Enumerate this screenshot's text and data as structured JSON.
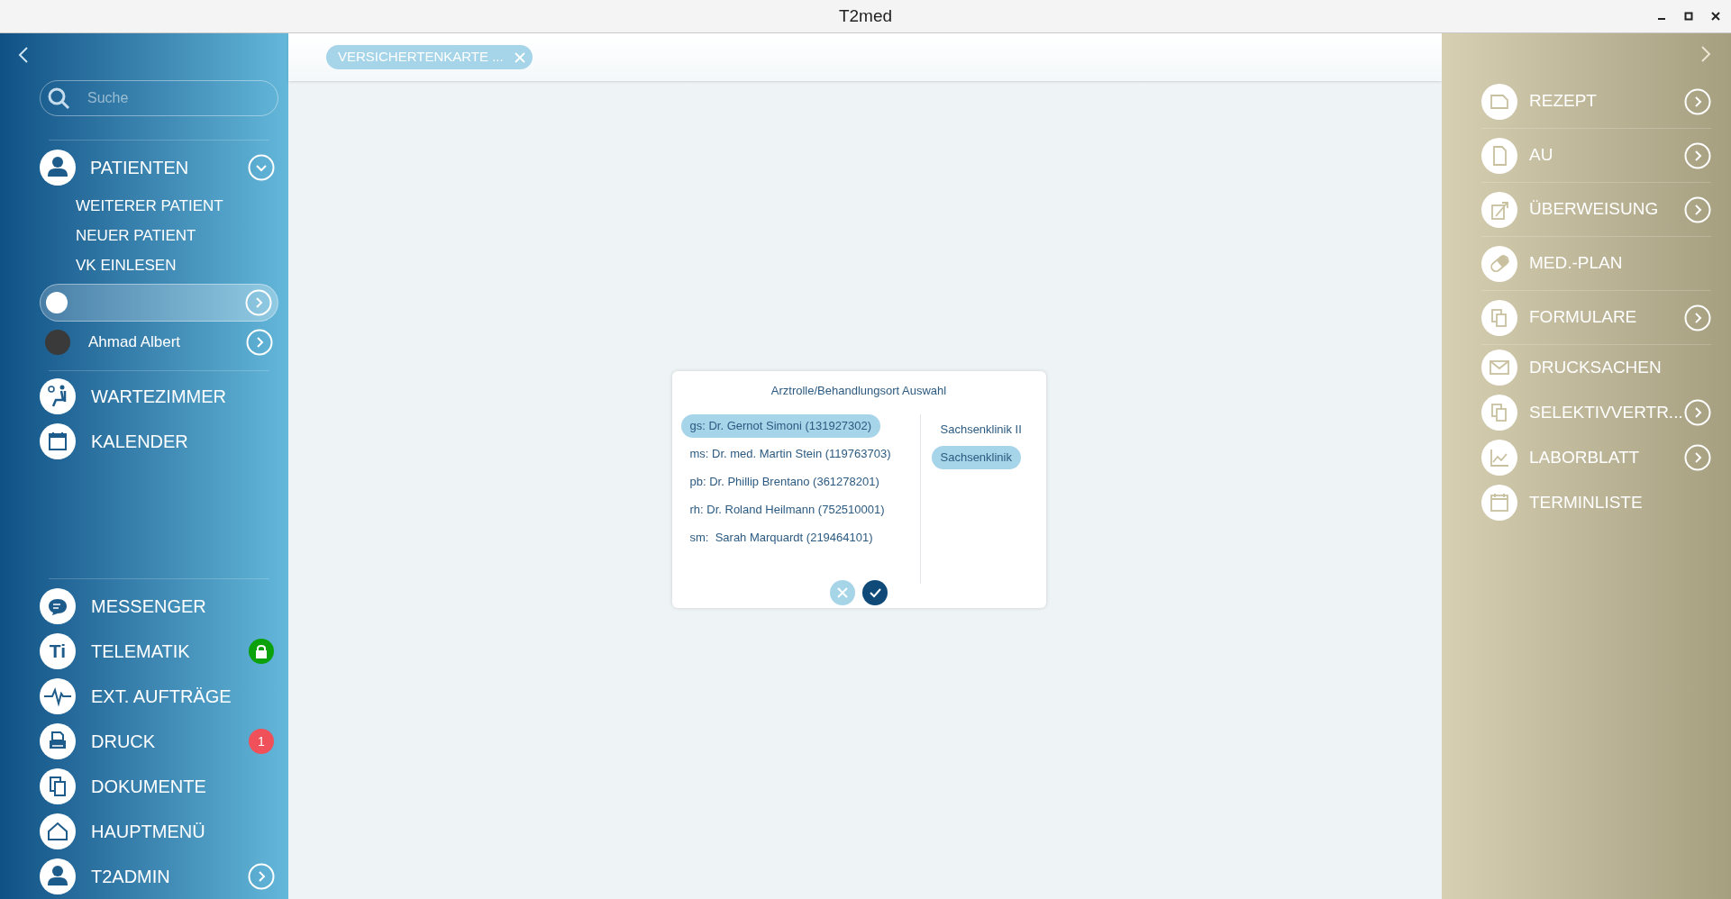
{
  "window": {
    "title": "T2med"
  },
  "sidebar": {
    "search": {
      "placeholder": "Suche"
    },
    "patients": {
      "label": "PATIENTEN",
      "expanded": true,
      "actions": [
        "WEITERER PATIENT",
        "NEUER PATIENT",
        "VK EINLESEN"
      ],
      "open": [
        {
          "selected": true,
          "kind": "silhouette"
        },
        {
          "name": "Ahmad Albert",
          "selected": false,
          "kind": "photo"
        }
      ]
    },
    "top_items": [
      {
        "label": "WARTEZIMMER"
      },
      {
        "label": "KALENDER"
      }
    ],
    "bottom_items": [
      {
        "label": "MESSENGER"
      },
      {
        "label": "TELEMATIK",
        "icon_text": "Ti",
        "badge": {
          "kind": "lock",
          "color": "#0aa10a"
        }
      },
      {
        "label": "EXT. AUFTRÄGE"
      },
      {
        "label": "DRUCK",
        "badge": {
          "kind": "count",
          "text": "1",
          "color": "#f0505a"
        }
      },
      {
        "label": "DOKUMENTE"
      },
      {
        "label": "HAUPTMENÜ"
      },
      {
        "label": "T2ADMIN",
        "has_arrow": true
      }
    ]
  },
  "tabs": [
    {
      "label": "VERSICHERTENKARTE ..."
    }
  ],
  "dialog": {
    "title": "Arztrolle/Behandlungsort Auswahl",
    "doctors": [
      {
        "label": "gs: Dr. Gernot Simoni (131927302)",
        "selected": true
      },
      {
        "label": "ms: Dr. med. Martin Stein (119763703)",
        "selected": false
      },
      {
        "label": "pb: Dr. Phillip Brentano (361278201)",
        "selected": false
      },
      {
        "label": "rh: Dr. Roland Heilmann (752510001)",
        "selected": false
      },
      {
        "label": "sm:  Sarah Marquardt (219464101)",
        "selected": false
      }
    ],
    "locations": [
      {
        "label": "Sachsenklinik II",
        "selected": false
      },
      {
        "label": "Sachsenklinik",
        "selected": true
      }
    ]
  },
  "right_panel": {
    "items": [
      {
        "label": "REZEPT",
        "has_arrow": true
      },
      {
        "label": "AU",
        "has_arrow": true
      },
      {
        "label": "ÜBERWEISUNG",
        "has_arrow": true
      },
      {
        "label": "MED.-PLAN",
        "has_arrow": false
      },
      {
        "label": "FORMULARE",
        "has_arrow": true
      },
      {
        "label": "DRUCKSACHEN",
        "has_arrow": false
      },
      {
        "label": "SELEKTIVVERTR...",
        "has_arrow": true
      },
      {
        "label": "LABORBLATT",
        "has_arrow": true
      },
      {
        "label": "TERMINLISTE",
        "has_arrow": false
      }
    ]
  }
}
